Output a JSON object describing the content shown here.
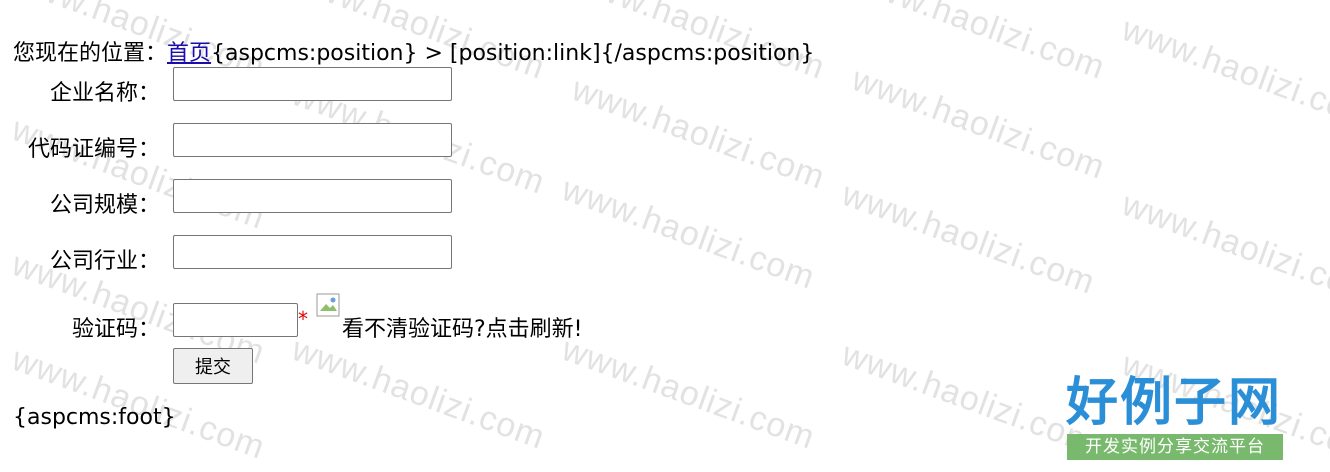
{
  "breadcrumb": {
    "prefix": "您现在的位置：",
    "home_link": "首页",
    "rest": "{aspcms:position} > [position:link]{/aspcms:position}"
  },
  "form": {
    "fields": [
      {
        "label": "企业名称：",
        "value": ""
      },
      {
        "label": "代码证编号：",
        "value": ""
      },
      {
        "label": "公司规模：",
        "value": ""
      },
      {
        "label": "公司行业：",
        "value": ""
      }
    ],
    "captcha": {
      "label": "验证码：",
      "value": "",
      "required_mark": "*",
      "refresh_text": "看不清验证码?点击刷新!"
    },
    "submit_label": "提交"
  },
  "footer": "{aspcms:foot}",
  "watermark": {
    "text": "www.haolizi.com",
    "logo_title": "好例子网",
    "logo_subtitle": "开发实例分享交流平台"
  },
  "colors": {
    "link": "#1a0dab",
    "required": "#e00000",
    "logo_blue": "#2b8fd8",
    "logo_green": "#79b96d"
  }
}
